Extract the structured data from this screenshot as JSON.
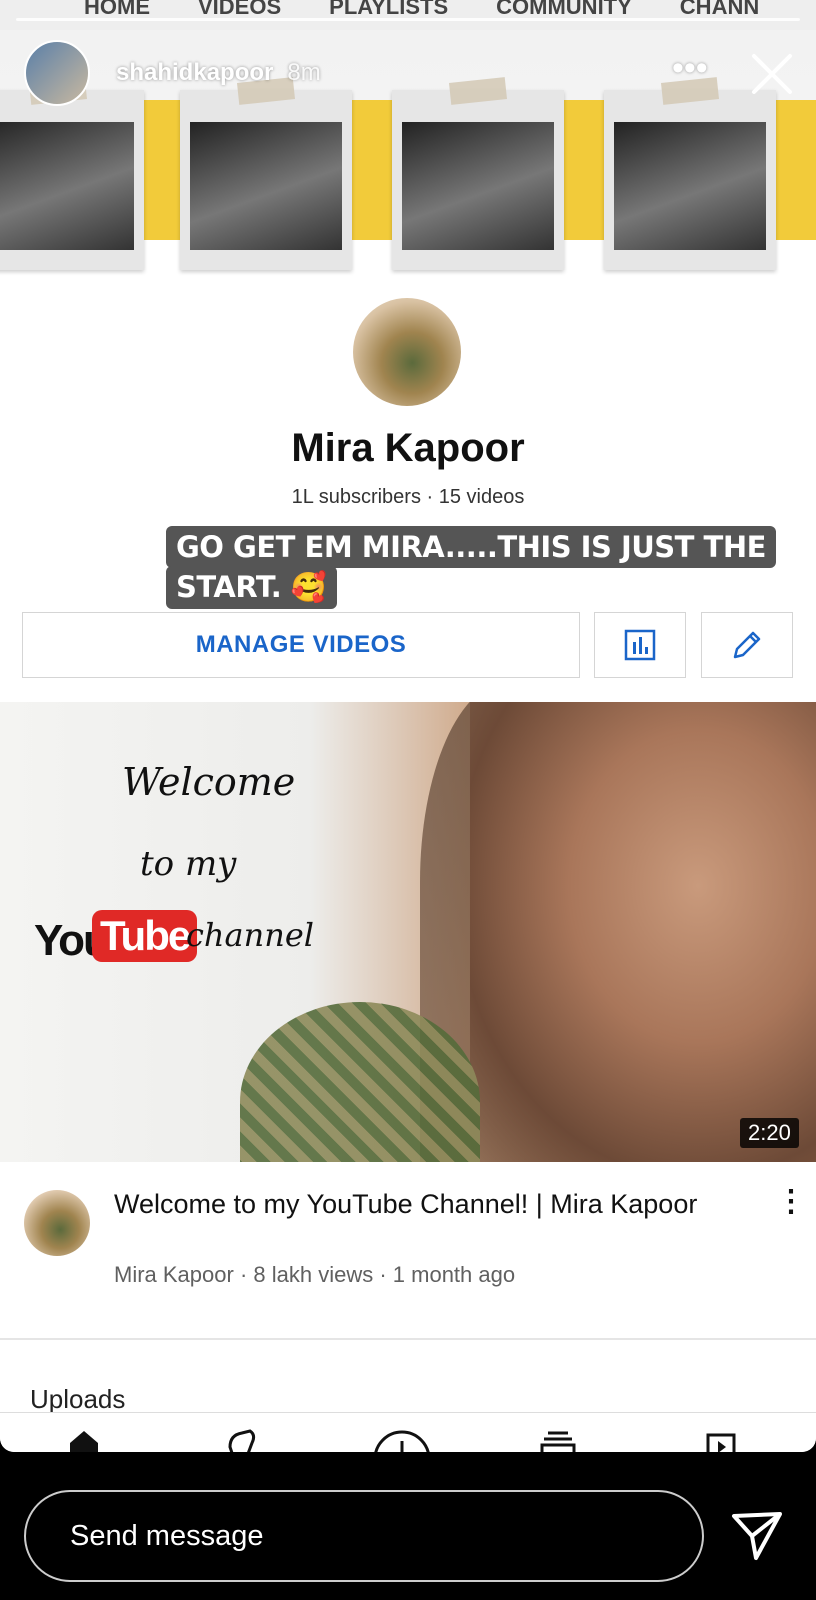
{
  "youtube_tabs": [
    "HOME",
    "VIDEOS",
    "PLAYLISTS",
    "COMMUNITY",
    "CHANN"
  ],
  "story": {
    "username": "shahidkapoor",
    "time": "8m",
    "more_icon": "more-horizontal-icon",
    "close_icon": "close-icon",
    "caption_lines": [
      "GO GET EM MIRA.....THIS IS JUST THE",
      "START. 🥰"
    ]
  },
  "channel": {
    "name": "Mira Kapoor",
    "stats": "1L subscribers · 15 videos",
    "manage_label": "MANAGE VIDEOS",
    "analytics_icon": "analytics-chart-icon",
    "edit_icon": "pencil-icon"
  },
  "featured_video": {
    "thumb_text": {
      "line1": "Welcome",
      "line2": "to my",
      "you": "You",
      "tube": "Tube",
      "channel": "channel"
    },
    "duration": "2:20",
    "title": "Welcome to my YouTube Channel! | Mira Kapoor",
    "channel": "Mira Kapoor",
    "meta": "· 8 lakh views · 1 month ago"
  },
  "uploads_label": "Uploads",
  "bottom_nav_icons": [
    "home-icon",
    "shorts-icon",
    "create-icon",
    "subscriptions-icon",
    "library-icon"
  ],
  "message": {
    "placeholder": "Send message",
    "send_icon": "send-icon"
  },
  "colors": {
    "accent_blue": "#1a65c9",
    "youtube_red": "#e02926",
    "banner_yellow": "#f2cb3a"
  }
}
